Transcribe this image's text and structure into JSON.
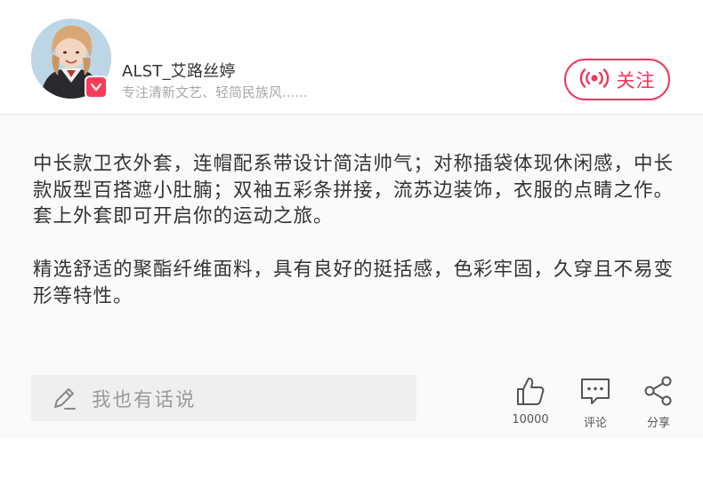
{
  "author": {
    "name": "ALST_艾路丝婷",
    "bio": "专注清新文艺、轻简民族风......",
    "avatar_icon": "avatar-portrait",
    "badge_icon": "verified-v-icon"
  },
  "follow_button": {
    "label": "关注",
    "icon": "live-broadcast-icon",
    "color": "#f0355c"
  },
  "post": {
    "paragraphs": [
      "中长款卫衣外套，连帽配系带设计简洁帅气；对称插袋体现休闲感，中长款版型百搭遮小肚腩；双袖五彩条拼接，流苏边装饰，衣服的点睛之作。套上外套即可开启你的运动之旅。",
      "精选舒适的聚酯纤维面料，具有良好的挺括感，色彩牢固，久穿且不易变形等特性。"
    ]
  },
  "comment_input": {
    "placeholder": "我也有话说",
    "icon": "pencil-icon"
  },
  "actions": {
    "like": {
      "icon": "thumbs-up-icon",
      "count": "10000"
    },
    "comment": {
      "icon": "comment-bubble-icon",
      "label": "评论"
    },
    "share": {
      "icon": "share-icon",
      "label": "分享"
    }
  }
}
